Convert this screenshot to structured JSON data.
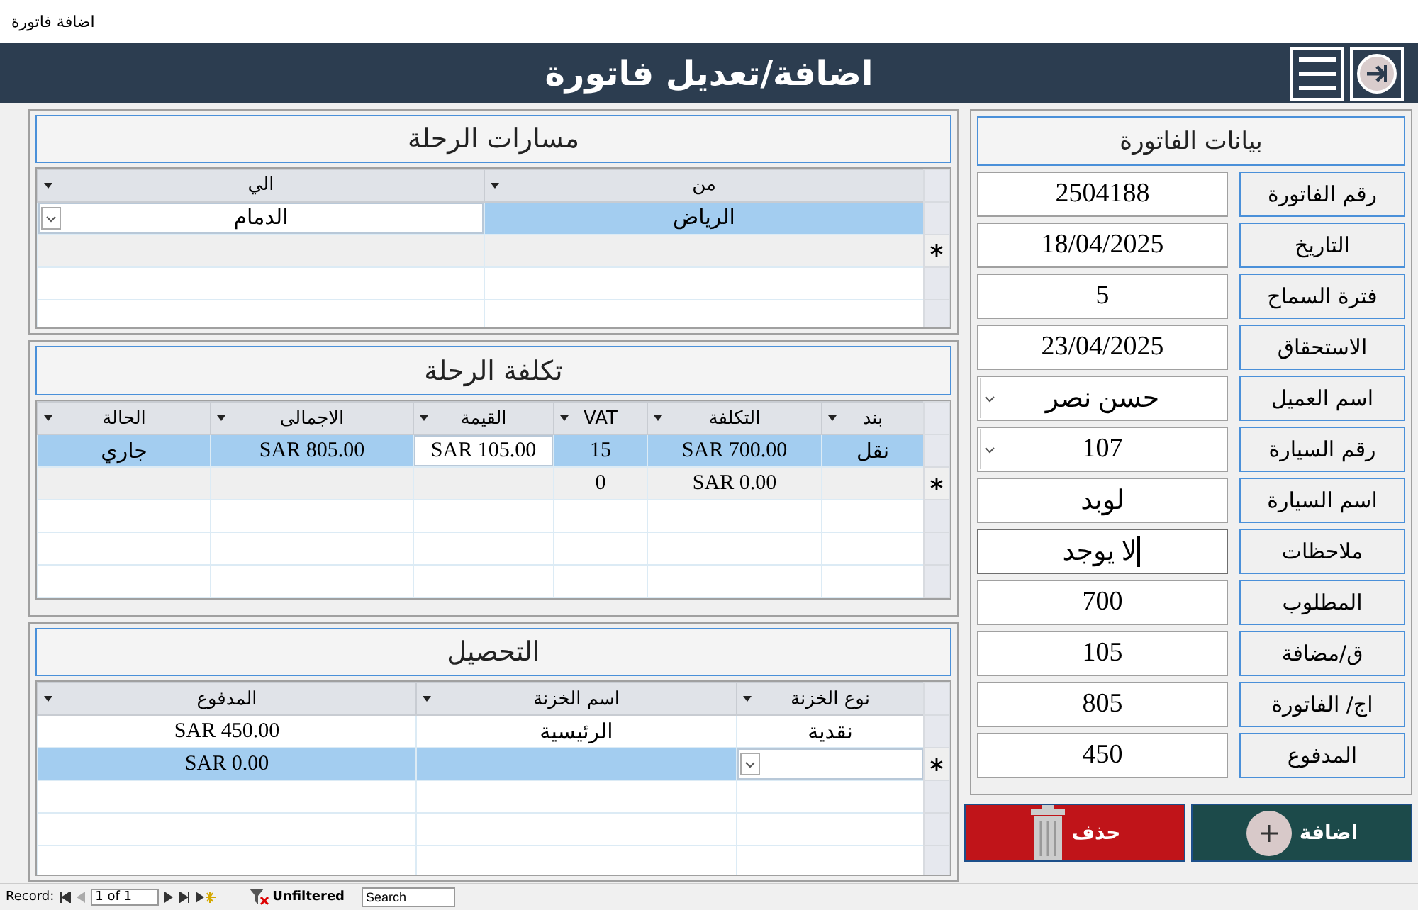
{
  "window": {
    "title": "اضافة فاتورة"
  },
  "header": {
    "title": "اضافة/تعديل فاتورة"
  },
  "invoice": {
    "title": "بيانات الفاتورة",
    "fields": [
      {
        "label": "رقم الفاتورة",
        "value": "2504188",
        "kind": "text",
        "focused": false
      },
      {
        "label": "التاريخ",
        "value": "18/04/2025",
        "kind": "text",
        "focused": false
      },
      {
        "label": "فترة السماح",
        "value": "5",
        "kind": "text",
        "focused": false
      },
      {
        "label": "الاستحقاق",
        "value": "23/04/2025",
        "kind": "text",
        "focused": false
      },
      {
        "label": "اسم العميل",
        "value": "حسن نصر",
        "kind": "combo",
        "focused": false
      },
      {
        "label": "رقم السيارة",
        "value": "107",
        "kind": "combo",
        "focused": false
      },
      {
        "label": "اسم السيارة",
        "value": "لوبد",
        "kind": "text",
        "focused": false
      },
      {
        "label": "ملاحظات",
        "value": "لا يوجد",
        "kind": "text",
        "focused": true
      },
      {
        "label": "المطلوب",
        "value": "700",
        "kind": "text",
        "focused": false
      },
      {
        "label": "ق/مضافة",
        "value": "105",
        "kind": "text",
        "focused": false
      },
      {
        "label": "اج/ الفاتورة",
        "value": "805",
        "kind": "text",
        "focused": false
      },
      {
        "label": "المدفوع",
        "value": "450",
        "kind": "text",
        "focused": false
      }
    ]
  },
  "buttons": [
    {
      "label": "اضافة",
      "kind": "add"
    },
    {
      "label": "حذف",
      "kind": "delete"
    }
  ],
  "grids": [
    {
      "title": "مسارات الرحلة",
      "columns": [
        "من",
        "الي"
      ],
      "rows": [
        {
          "cells": [
            {
              "text": "الرياض",
              "current": false
            },
            {
              "text": "الدمام",
              "current": true,
              "dropdown": true
            }
          ],
          "selected": true,
          "new_record": false
        },
        {
          "cells": [
            {
              "current": false
            },
            {
              "current": false
            }
          ],
          "selected": false,
          "new_record": true
        }
      ]
    },
    {
      "title": "تكلفة الرحلة",
      "columns": [
        "بند",
        "التكلفة",
        "VAT",
        "القيمة",
        "الاجمالى",
        "الحالة"
      ],
      "rows": [
        {
          "cells": [
            {
              "text": "نقل",
              "current": false
            },
            {
              "text": "SAR 700.00",
              "current": false
            },
            {
              "text": "15",
              "current": false
            },
            {
              "text": "SAR 105.00",
              "current": true,
              "dropdown": false
            },
            {
              "text": "SAR 805.00",
              "current": false
            },
            {
              "text": "جاري",
              "current": false
            }
          ],
          "selected": true,
          "new_record": false
        },
        {
          "cells": [
            {
              "current": false
            },
            {
              "text": "SAR 0.00",
              "current": false
            },
            {
              "text": "0",
              "current": false
            },
            {
              "current": false
            },
            {
              "current": false
            },
            {
              "current": false
            }
          ],
          "selected": false,
          "new_record": true
        }
      ]
    },
    {
      "title": "التحصيل",
      "columns": [
        "نوع الخزنة",
        "اسم الخزنة",
        "المدفوع"
      ],
      "rows": [
        {
          "cells": [
            {
              "text": "نقدية",
              "current": false
            },
            {
              "text": "الرئيسية",
              "current": false
            },
            {
              "text": "SAR 450.00",
              "current": false
            }
          ],
          "selected": false,
          "new_record": false
        },
        {
          "cells": [
            {
              "current": true,
              "dropdown": true
            },
            {
              "current": false
            },
            {
              "text": "SAR 0.00",
              "current": false
            }
          ],
          "selected": true,
          "new_record": true
        }
      ]
    }
  ],
  "status_bar": {
    "record_label": "Record:",
    "position": "1 of 1",
    "filter": "Unfiltered",
    "search_placeholder": "Search"
  }
}
